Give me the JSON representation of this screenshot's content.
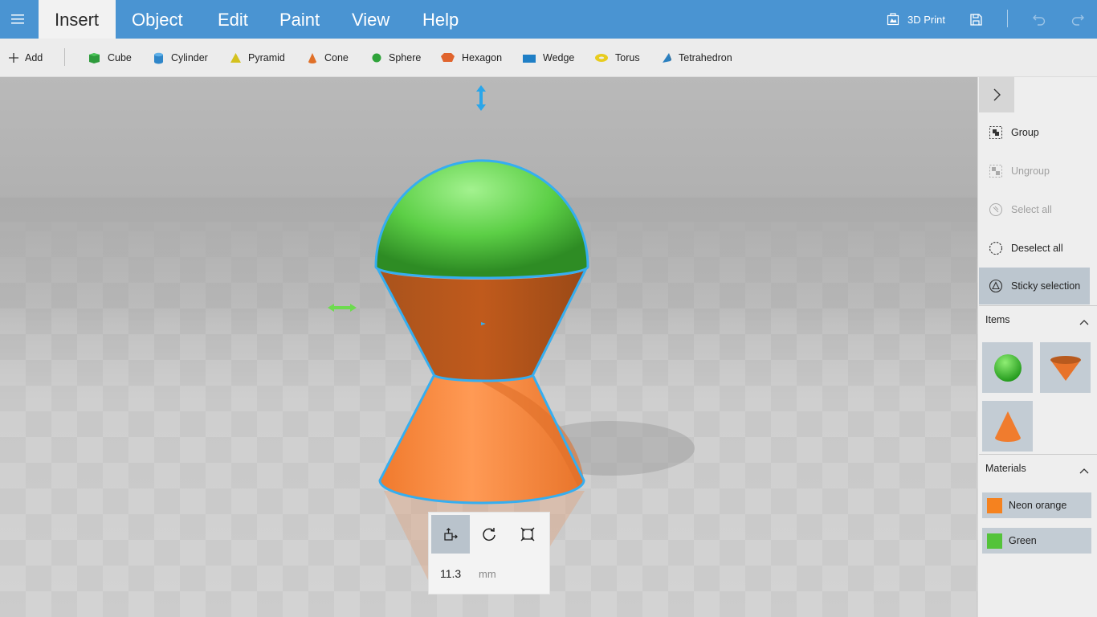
{
  "menu": {
    "tabs": [
      {
        "label": "Insert",
        "active": true
      },
      {
        "label": "Object"
      },
      {
        "label": "Edit"
      },
      {
        "label": "Paint"
      },
      {
        "label": "View"
      },
      {
        "label": "Help"
      }
    ],
    "print_label": "3D Print",
    "icons": [
      "hamburger-icon",
      "printer-icon",
      "save-icon",
      "undo-icon",
      "redo-icon"
    ]
  },
  "toolbar": {
    "add_label": "Add",
    "shapes": [
      {
        "label": "Cube",
        "color": "#2e9b3c"
      },
      {
        "label": "Cylinder",
        "color": "#2f86c9"
      },
      {
        "label": "Pyramid",
        "color": "#d4c11e"
      },
      {
        "label": "Cone",
        "color": "#e07028"
      },
      {
        "label": "Sphere",
        "color": "#2fa33a"
      },
      {
        "label": "Hexagon",
        "color": "#e0642d"
      },
      {
        "label": "Wedge",
        "color": "#1f7fc6"
      },
      {
        "label": "Torus",
        "color": "#e8cc1e"
      },
      {
        "label": "Tetrahedron",
        "color": "#2a7fbf"
      }
    ]
  },
  "transform": {
    "value": "11.3",
    "unit": "mm",
    "tools": [
      "move-icon",
      "rotate-icon",
      "scale-icon"
    ]
  },
  "right_panel": {
    "actions": [
      {
        "label": "Group",
        "enabled": true
      },
      {
        "label": "Ungroup",
        "enabled": false
      },
      {
        "label": "Select all",
        "enabled": false
      },
      {
        "label": "Deselect all",
        "enabled": true
      },
      {
        "label": "Sticky selection",
        "enabled": true,
        "active": true
      }
    ],
    "items_title": "Items",
    "items": [
      "sphere",
      "cone-inverted",
      "cone"
    ],
    "materials_title": "Materials",
    "materials": [
      {
        "label": "Neon orange",
        "color": "#f5821f"
      },
      {
        "label": "Green",
        "color": "#53c33a"
      }
    ]
  },
  "colors": {
    "accent": "#4a94d2",
    "selection": "#35aef0",
    "orange": "#f5821f",
    "green": "#53c33a"
  }
}
